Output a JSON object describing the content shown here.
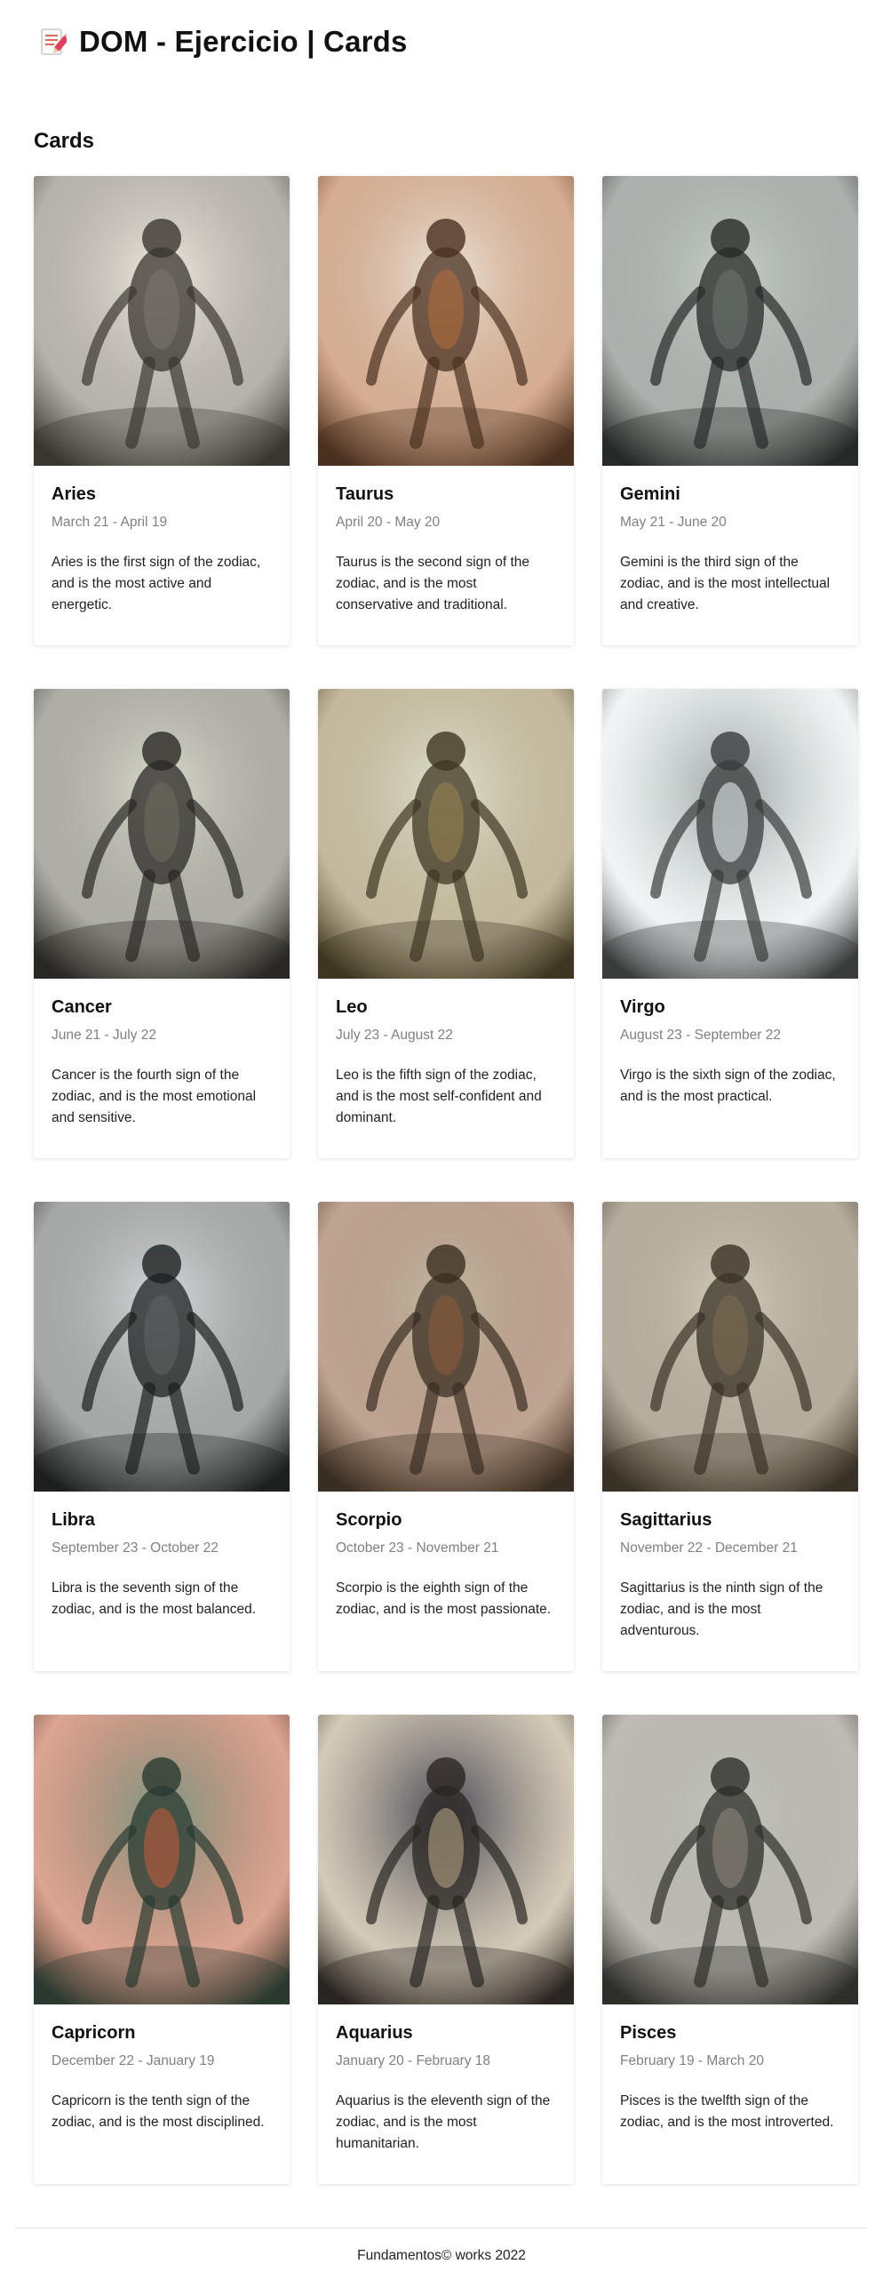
{
  "header": {
    "icon": "document-pencil-icon",
    "title": "DOM - Ejercicio | Cards"
  },
  "section": {
    "title": "Cards"
  },
  "cards": [
    {
      "title": "Aries",
      "date": "March 21 - April 19",
      "description": "Aries is the first sign of the zodiac, and is the most active and energetic.",
      "image": "aries-creature-image",
      "palette": [
        "#f2ece0",
        "#7a746a",
        "#3a3630"
      ]
    },
    {
      "title": "Taurus",
      "date": "April 20 - May 20",
      "description": "Taurus is the second sign of the zodiac, and is the most conservative and traditional.",
      "image": "taurus-creature-image",
      "palette": [
        "#ece6dc",
        "#b06a3a",
        "#4a3020"
      ]
    },
    {
      "title": "Gemini",
      "date": "May 21 - June 20",
      "description": "Gemini is the third sign of the zodiac, and is the most intellectual and creative.",
      "image": "gemini-creature-image",
      "palette": [
        "#c9d0c8",
        "#6a716c",
        "#262a28"
      ]
    },
    {
      "title": "Cancer",
      "date": "June 21 - July 22",
      "description": "Cancer is the fourth sign of the zodiac, and is the most emotional and sensitive.",
      "image": "cancer-creature-image",
      "palette": [
        "#dcdccf",
        "#6c6a5e",
        "#2a2824"
      ]
    },
    {
      "title": "Leo",
      "date": "July 23 - August 22",
      "description": "Leo is the fifth sign of the zodiac, and is the most self-confident and dominant.",
      "image": "leo-creature-image",
      "palette": [
        "#dfe2d2",
        "#94804e",
        "#3e3622"
      ]
    },
    {
      "title": "Virgo",
      "date": "August 23 - September 22",
      "description": "Virgo is the sixth sign of the zodiac, and is the most practical.",
      "image": "virgo-creature-image",
      "palette": [
        "#9fa8a6",
        "#e6ecec",
        "#3a3c3c"
      ]
    },
    {
      "title": "Libra",
      "date": "September 23 - October 22",
      "description": "Libra is the seventh sign of the zodiac, and is the most balanced.",
      "image": "libra-creature-image",
      "palette": [
        "#d8dcdc",
        "#5e6060",
        "#1e2020"
      ]
    },
    {
      "title": "Scorpio",
      "date": "October 23 - November 21",
      "description": "Scorpio is the eighth sign of the zodiac, and is the most passionate.",
      "image": "scorpio-creature-image",
      "palette": [
        "#c2b8a2",
        "#8a5a3a",
        "#3a2e22"
      ]
    },
    {
      "title": "Sagittarius",
      "date": "November 22 - December 21",
      "description": "Sagittarius is the ninth sign of the zodiac, and is the most adventurous.",
      "image": "sagittarius-creature-image",
      "palette": [
        "#d2cdbb",
        "#7a6a50",
        "#3a3226"
      ]
    },
    {
      "title": "Capricorn",
      "date": "December 22 - January 19",
      "description": "Capricorn is the tenth sign of the zodiac, and is the most disciplined.",
      "image": "capricorn-creature-image",
      "palette": [
        "#7c9a86",
        "#c05a3a",
        "#2a3a30"
      ]
    },
    {
      "title": "Aquarius",
      "date": "January 20 - February 18",
      "description": "Aquarius is the eleventh sign of the zodiac, and is the most humanitarian.",
      "image": "aquarius-creature-image",
      "palette": [
        "#4a4a5a",
        "#b0a080",
        "#2a2622"
      ]
    },
    {
      "title": "Pisces",
      "date": "February 19 - March 20",
      "description": "Pisces is the twelfth sign of the zodiac, and is the most introverted.",
      "image": "pisces-creature-image",
      "palette": [
        "#c2c6be",
        "#8a8478",
        "#2e2e2a"
      ]
    }
  ],
  "footer": {
    "text": "Fundamentos© works 2022"
  }
}
